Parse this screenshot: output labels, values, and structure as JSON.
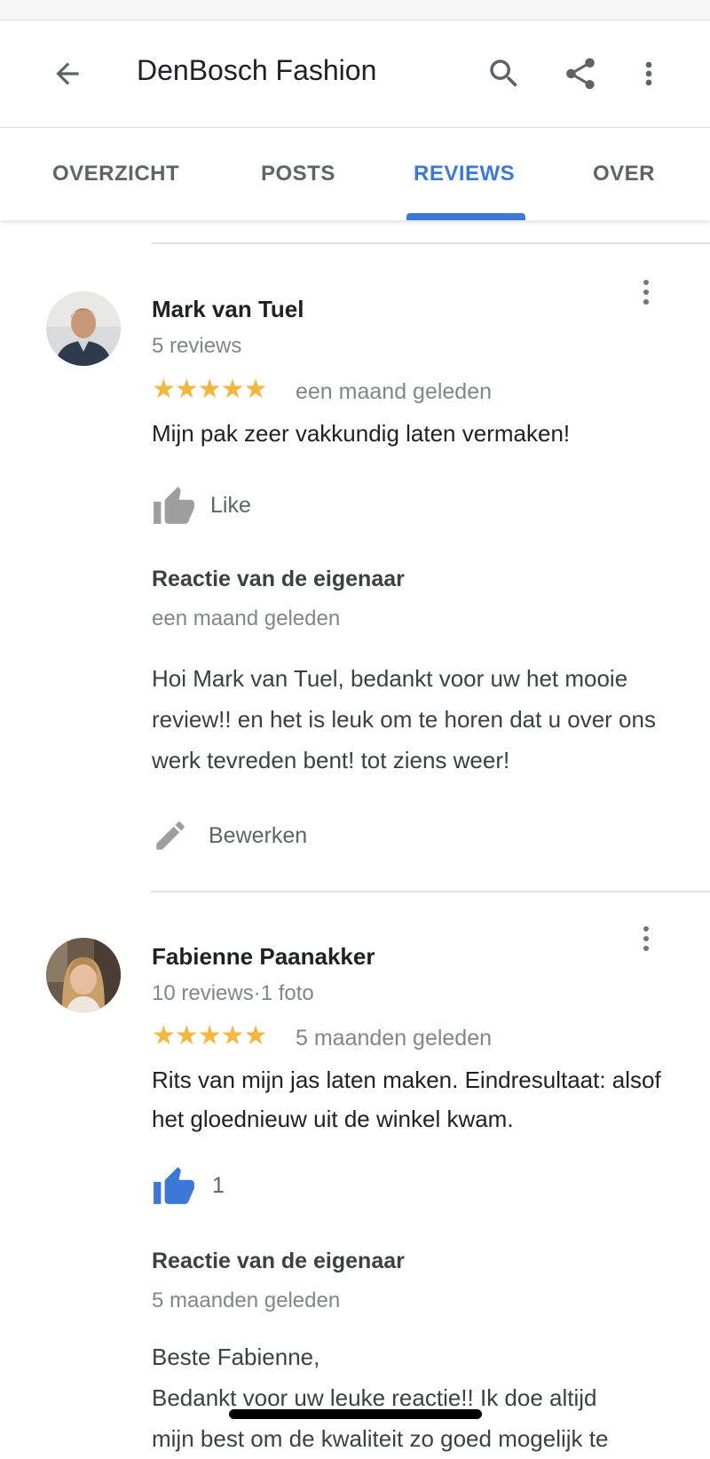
{
  "header": {
    "title": "DenBosch Fashion",
    "back_icon": "arrow-left-icon",
    "search_icon": "search-icon",
    "share_icon": "share-icon",
    "more_icon": "more-vert-icon"
  },
  "tabs": [
    {
      "label": "OVERZICHT",
      "active": false
    },
    {
      "label": "POSTS",
      "active": false
    },
    {
      "label": "REVIEWS",
      "active": true
    },
    {
      "label": "OVER",
      "active": false
    }
  ],
  "colors": {
    "accent": "#3c78d8",
    "star": "#f4b63f",
    "secondary_text": "#80868b"
  },
  "reviews": [
    {
      "name": "Mark van Tuel",
      "meta": "5 reviews",
      "stars": "★★★★★",
      "rating": 5,
      "date": "een maand geleden",
      "text": "Mijn pak zeer vakkundig laten vermaken!",
      "like_label": "Like",
      "liked": false,
      "owner_reply_title": "Reactie van de eigenaar",
      "owner_reply_date": "een maand geleden",
      "owner_reply_text": "Hoi Mark van Tuel, bedankt voor uw het mooie review!! en het is leuk om te horen dat u over ons werk tevreden bent! tot ziens weer!",
      "edit_label": "Bewerken"
    },
    {
      "name": "Fabienne Paanakker",
      "meta": "10 reviews·1 foto",
      "stars": "★★★★★",
      "rating": 5,
      "date": "5 maanden geleden",
      "text": "Rits van mijn jas laten maken. Eindresultaat: alsof het gloednieuw uit de winkel kwam.",
      "like_count": "1",
      "liked": true,
      "owner_reply_title": "Reactie van de eigenaar",
      "owner_reply_date": "5 maanden geleden",
      "owner_reply_text_line1": "Beste Fabienne,",
      "owner_reply_text_line2": "Bedankt voor uw leuke reactie!! Ik doe altijd",
      "owner_reply_text_line3": "mijn best om de kwaliteit zo goed mogelijk te"
    }
  ]
}
